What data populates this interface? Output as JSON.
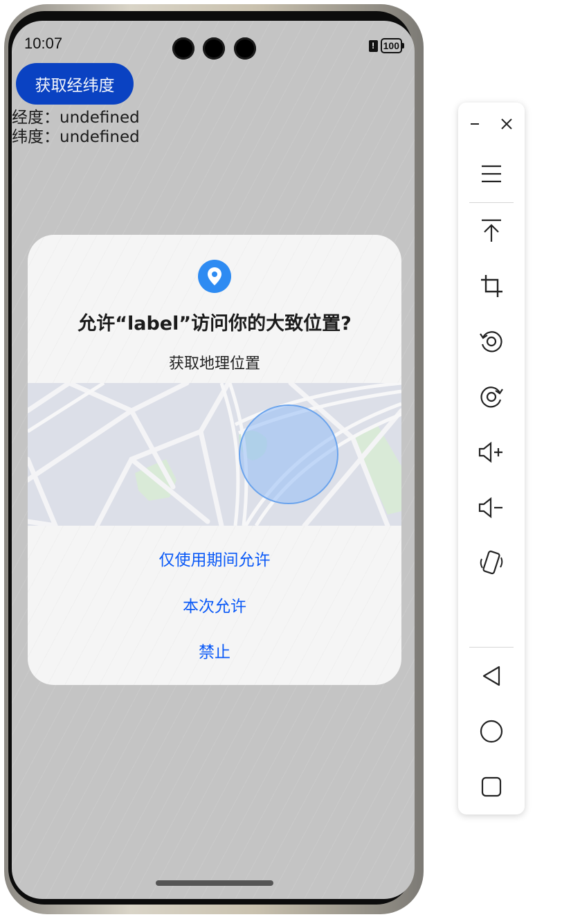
{
  "status_bar": {
    "time": "10:07",
    "battery": "100",
    "warning_glyph": "!"
  },
  "app": {
    "get_button_label": "获取经纬度",
    "longitude_label": "经度：",
    "longitude_value": "undefined",
    "latitude_label": "纬度：",
    "latitude_value": "undefined"
  },
  "dialog": {
    "icon": "location-pin-icon",
    "title": "允许“label”访问你的大致位置?",
    "subtitle": "获取地理位置",
    "options": {
      "while_using": "仅使用期间允许",
      "once": "本次允许",
      "deny": "禁止"
    },
    "accent_color": "#0a59f7"
  },
  "toolbar": {
    "icons": [
      "minimize-icon",
      "close-icon",
      "menu-icon",
      "pin-to-top-icon",
      "screenshot-crop-icon",
      "rotate-left-icon",
      "rotate-right-icon",
      "volume-up-icon",
      "volume-down-icon",
      "shake-icon",
      "back-icon",
      "home-icon",
      "recents-icon"
    ]
  }
}
